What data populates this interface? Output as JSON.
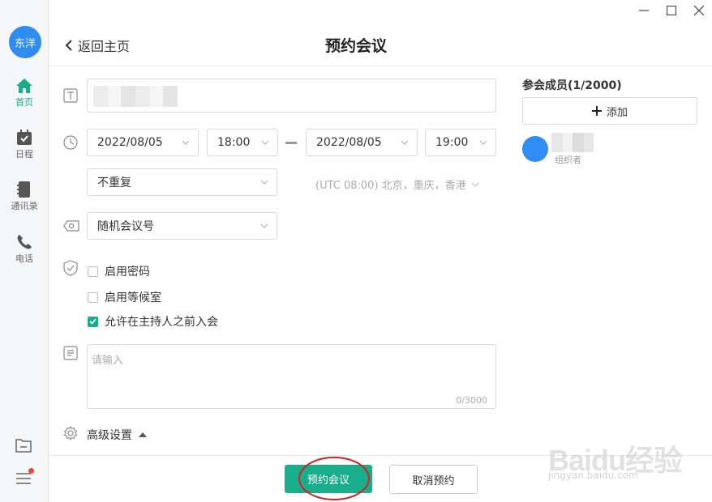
{
  "user": {
    "avatar_text": "东洋"
  },
  "sidebar": {
    "items": [
      {
        "label": "首页",
        "icon": "home-icon",
        "active": true
      },
      {
        "label": "日程",
        "icon": "calendar-icon"
      },
      {
        "label": "通讯录",
        "icon": "contacts-icon"
      },
      {
        "label": "电话",
        "icon": "phone-icon"
      }
    ]
  },
  "header": {
    "back_label": "返回主页",
    "title": "预约会议"
  },
  "form": {
    "start_date": "2022/08/05",
    "start_time": "18:00",
    "end_date": "2022/08/05",
    "end_time": "19:00",
    "repeat": "不重复",
    "timezone": "(UTC 08:00) 北京，重庆，香港",
    "meeting_id": "随机会议号",
    "checkboxes": [
      {
        "label": "启用密码",
        "checked": false
      },
      {
        "label": "启用等候室",
        "checked": false
      },
      {
        "label": "允许在主持人之前入会",
        "checked": true
      }
    ],
    "description_placeholder": "请输入",
    "description_count": "0/3000",
    "advanced_label": "高级设置"
  },
  "members": {
    "title": "参会成员(1/2000)",
    "add_label": "添加",
    "list": [
      {
        "role": "组织者"
      }
    ]
  },
  "actions": {
    "submit_label": "预约会议",
    "cancel_label": "取消预约"
  },
  "watermark": {
    "text": "Baidu经验",
    "sub": "jingyan.baidu.com"
  },
  "colors": {
    "accent": "#1aad8c",
    "avatar_blue": "#2f8cf0"
  }
}
